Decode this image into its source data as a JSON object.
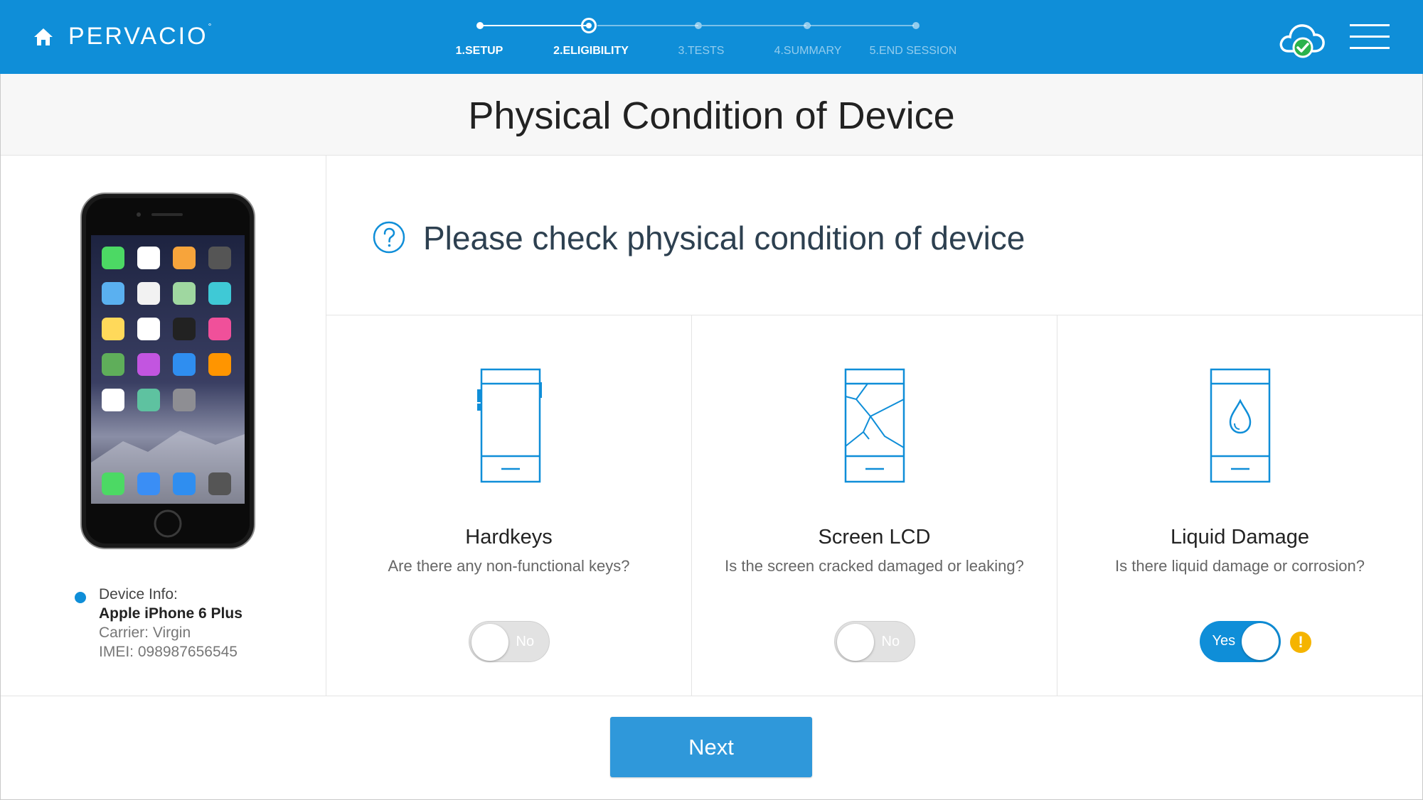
{
  "header": {
    "brand": "PERVACIO",
    "brand_mark": "°",
    "steps": [
      {
        "label": "1.SETUP",
        "state": "done"
      },
      {
        "label": "2.ELIGIBILITY",
        "state": "current"
      },
      {
        "label": "3.TESTS",
        "state": "pending"
      },
      {
        "label": "4.SUMMARY",
        "state": "pending"
      },
      {
        "label": "5.END SESSION",
        "state": "pending"
      }
    ],
    "icons": {
      "home": "home-icon",
      "cloud": "cloud-check-icon",
      "menu": "hamburger-menu-icon"
    }
  },
  "page_title": "Physical Condition of Device",
  "device": {
    "heading": "Device Info:",
    "model": "Apple iPhone 6 Plus",
    "carrier": "Carrier: Virgin",
    "imei": "IMEI: 098987656545",
    "image": "iphone-image"
  },
  "question": "Please check physical condition of device",
  "checks": [
    {
      "title": "Hardkeys",
      "subtitle": "Are there any  non-functional keys?",
      "toggle_label": "No",
      "value": false,
      "icon": "phone-hardkeys-icon"
    },
    {
      "title": "Screen LCD",
      "subtitle": "Is the screen cracked damaged or leaking?",
      "toggle_label": "No",
      "value": false,
      "icon": "phone-cracked-screen-icon"
    },
    {
      "title": "Liquid Damage",
      "subtitle": "Is there liquid damage or corrosion?",
      "toggle_label": "Yes",
      "value": true,
      "icon": "phone-liquid-damage-icon",
      "warning": "!"
    }
  ],
  "next_label": "Next",
  "colors": {
    "accent": "#0f8ed8",
    "warning": "#f5b400",
    "button": "#2f98da"
  }
}
